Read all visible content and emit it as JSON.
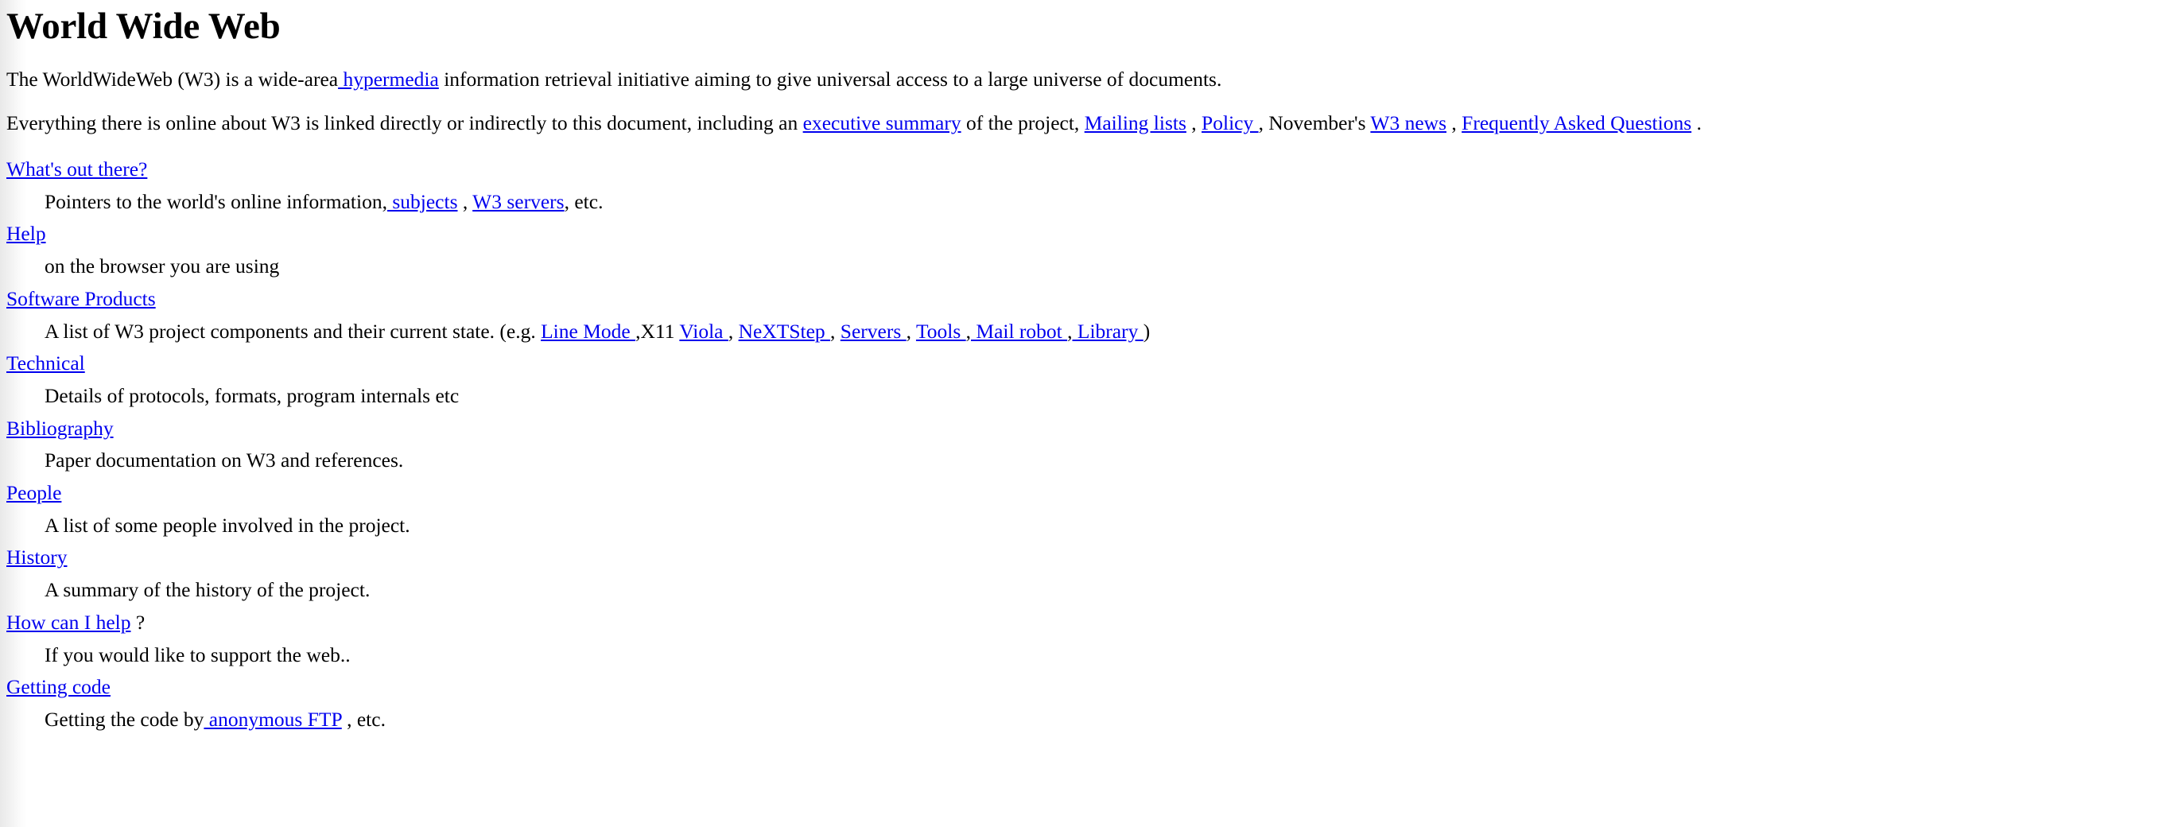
{
  "document": {
    "title": "World Wide Web",
    "link_color": "#0000ee",
    "text_color": "#000000",
    "background_color": "#ffffff"
  },
  "paragraphs": {
    "p1": {
      "before_link": "The WorldWideWeb (W3) is a wide-area",
      "link": " hypermedia",
      "after_link": " information retrieval initiative aiming to give universal access to a large universe of documents."
    },
    "p2": {
      "s1": "Everything there is online about W3 is linked directly or indirectly to this document, including an ",
      "link1": "executive summary",
      "s2": " of the project, ",
      "link2": "Mailing lists",
      "s3": " , ",
      "link3": "Policy ",
      "s4": ", November's ",
      "link4": "W3 news",
      "s5": " , ",
      "link5": "Frequently Asked Questions",
      "s6": " ."
    }
  },
  "index": [
    {
      "term": "What's out there?",
      "term_is_link": true,
      "desc": {
        "s1": "Pointers to the world's online information,",
        "link1": " subjects",
        "s2": " , ",
        "link2": "W3 servers",
        "s3": ", etc."
      }
    },
    {
      "term": "Help",
      "term_is_link": true,
      "desc": {
        "s1": "on the browser you are using"
      }
    },
    {
      "term": "Software Products",
      "term_is_link": true,
      "desc": {
        "s1": "A list of W3 project components and their current state. (e.g. ",
        "link1": "Line Mode ",
        "s2": ",X11 ",
        "link2": "Viola ",
        "s3": ", ",
        "link3": "NeXTStep ",
        "s4": ", ",
        "link4": "Servers ",
        "s5": ", ",
        "link5": "Tools ",
        "s6": ",",
        "link6": " Mail robot ",
        "s7": ",",
        "link7": " Library ",
        "s8": ")"
      }
    },
    {
      "term": "Technical",
      "term_is_link": true,
      "desc": {
        "s1": "Details of protocols, formats, program internals etc"
      }
    },
    {
      "term": "Bibliography",
      "term_is_link": true,
      "desc": {
        "s1": "Paper documentation on W3 and references."
      }
    },
    {
      "term": "People ",
      "term_is_link": true,
      "desc": {
        "s1": "A list of some people involved in the project."
      }
    },
    {
      "term": "History",
      "term_is_link": true,
      "desc": {
        "s1": "A summary of the history of the project."
      }
    },
    {
      "term": "How can I help",
      "term_is_link": true,
      "term_suffix": " ?",
      "desc": {
        "s1": "If you would like to support the web.."
      }
    },
    {
      "term": "Getting code",
      "term_is_link": true,
      "desc": {
        "s1": "Getting the code by",
        "link1": " anonymous FTP",
        "s2": " , etc."
      }
    }
  ]
}
